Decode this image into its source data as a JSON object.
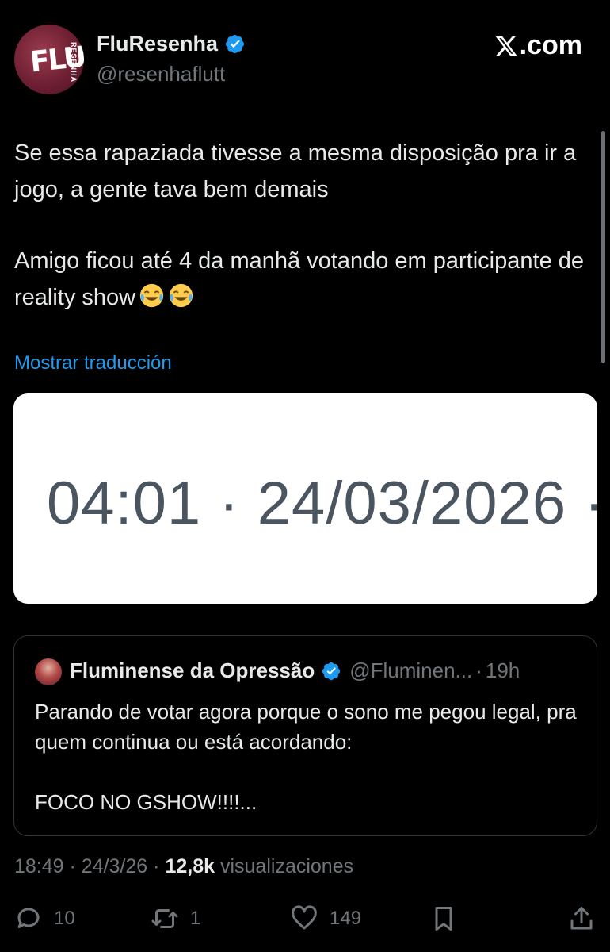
{
  "author": {
    "display_name": "FluResenha",
    "handle": "@resenhaflutt",
    "avatar_text": "FLU",
    "avatar_side_text": "RESENHA"
  },
  "brand": {
    "label": ".com"
  },
  "tweet": {
    "paragraphs": [
      "Se essa rapaziada tivesse a mesma disposição pra ir a jogo, a gente tava bem demais",
      "Amigo ficou até 4 da manhã votando em participante de reality show"
    ],
    "emoji": [
      "face-with-tears-of-joy",
      "face-with-tears-of-joy"
    ],
    "translate_label": "Mostrar traducción"
  },
  "image": {
    "text": "04:01 · 24/03/2026 ·"
  },
  "quoted": {
    "display_name": "Fluminense da Opressão",
    "handle": "@Fluminen...",
    "separator": "·",
    "time": "19h",
    "paragraphs": [
      "Parando de votar agora porque o sono me pegou legal, pra quem continua ou está acordando:",
      "FOCO NO GSHOW!!!!..."
    ]
  },
  "meta": {
    "time": "18:49",
    "date": "24/3/26",
    "sep": "·",
    "views_count": "12,8k",
    "views_label": "visualizaciones"
  },
  "actions": {
    "reply_count": "10",
    "retweet_count": "1",
    "like_count": "149"
  },
  "colors": {
    "background": "#000000",
    "text": "#e7e9ea",
    "muted": "#71767b",
    "link": "#1d9bf0",
    "verified": "#1d9bf0",
    "border": "#2f3336"
  }
}
